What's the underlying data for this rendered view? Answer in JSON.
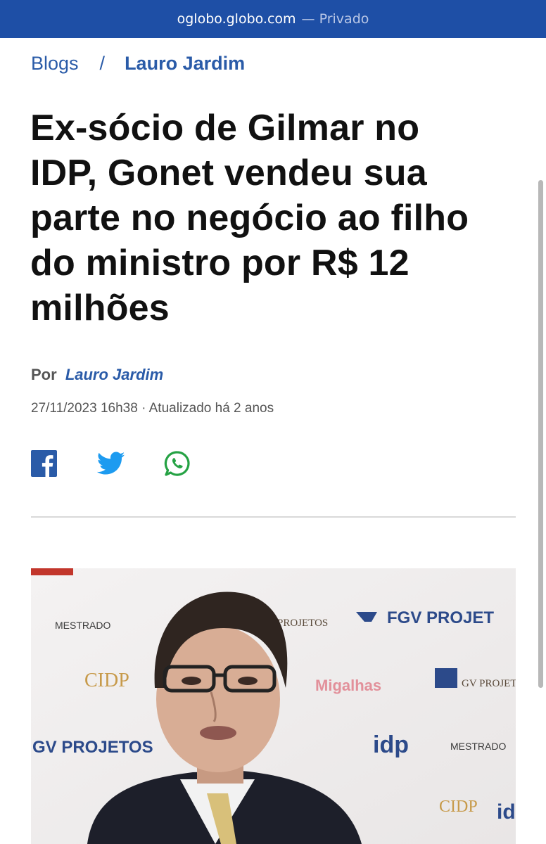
{
  "browser": {
    "domain": "oglobo.globo.com",
    "mode_label": "— Privado"
  },
  "breadcrumb": {
    "section": "Blogs",
    "separator": "/",
    "blog": "Lauro Jardim"
  },
  "article": {
    "headline_lines": [
      "Ex-sócio de Gilmar no",
      "IDP, Gonet vendeu sua",
      "parte no negócio ao filho",
      "do ministro por R$ 12",
      "milhões"
    ],
    "byline_prefix": "Por",
    "author": "Lauro Jardim",
    "dateline": "27/11/2023 16h38 · Atualizado há 2 anos"
  },
  "share": {
    "icons": [
      "facebook-icon",
      "twitter-icon",
      "whatsapp-icon"
    ],
    "colors": {
      "facebook": "#2a5ba8",
      "twitter": "#1d9bf0",
      "whatsapp": "#25a244"
    }
  },
  "photo": {
    "backdrop_texts": [
      "MESTRADO",
      "FGV PROJET",
      "PROJETOS",
      "GV PROJETOS",
      "MESTRADO",
      "CIDP",
      "idp",
      "CIDP",
      "id"
    ]
  },
  "colors": {
    "urlbar": "#1e4fa6",
    "link": "#2a5ba8",
    "headline": "#111111"
  }
}
